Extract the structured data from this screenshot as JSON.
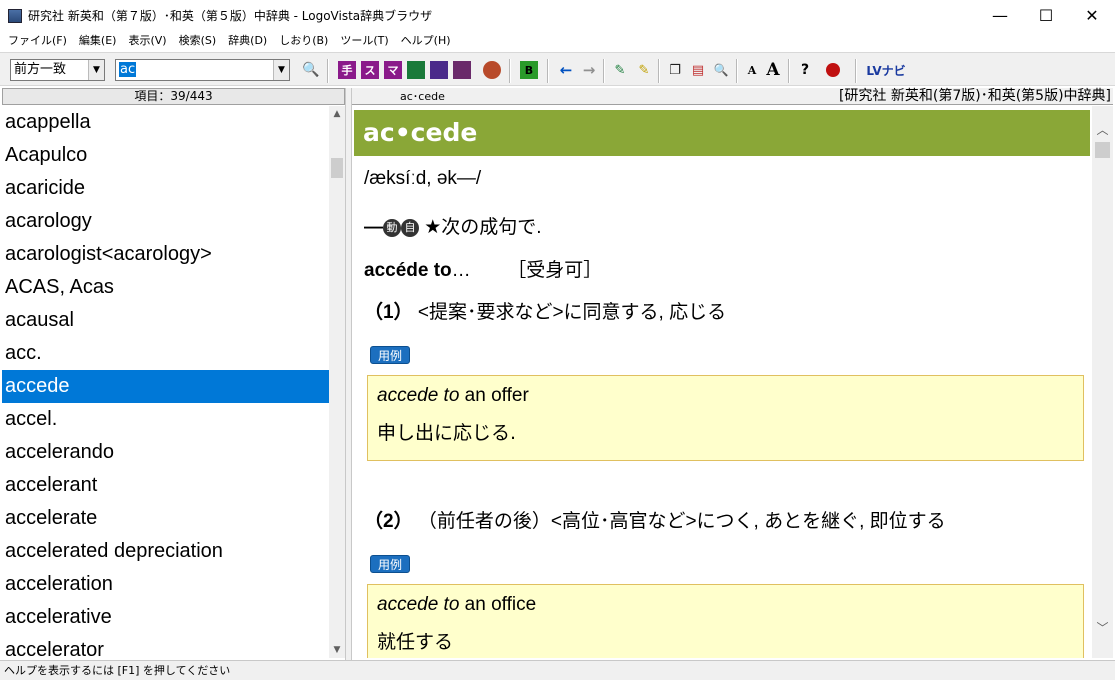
{
  "window": {
    "title": "研究社 新英和（第７版）･和英（第５版）中辞典 - LogoVista辞典ブラウザ",
    "minimize": "—",
    "maximize": "☐",
    "close": "✕"
  },
  "menu": [
    "ファイル(F)",
    "編集(E)",
    "表示(V)",
    "検索(S)",
    "辞典(D)",
    "しおり(B)",
    "ツール(T)",
    "ヘルプ(H)"
  ],
  "toolbar": {
    "search_mode": "前方一致",
    "search_query": "ac",
    "buttons": {
      "find": "🔍",
      "te": "手",
      "su": "ス",
      "ma": "マ",
      "b": "B",
      "back": "←",
      "forward": "→",
      "zoom": "🔍",
      "font_small": "A",
      "font_large": "A",
      "help": "?",
      "lv": "LVナビ"
    }
  },
  "left_pane": {
    "header": "項目：39/443",
    "items": [
      "acappella",
      "Acapulco",
      "acaricide",
      "acarology",
      "acarologist<acarology>",
      "ACAS, Acas",
      "acausal",
      "acc.",
      "accede",
      "accel.",
      "accelerando",
      "accelerant",
      "accelerate",
      "accelerated depreciation",
      "acceleration",
      "accelerative",
      "accelerator"
    ],
    "selected_index": 8
  },
  "right_pane": {
    "tab_label": "ac･cede",
    "dictionary_name": "[研究社 新英和(第7版)･和英(第5版)中辞典]",
    "headword": "ac•cede",
    "pronunciation": "/æksíːd, ək—/",
    "pos_dash": "—",
    "pos_verb": "動",
    "pos_intr": "自",
    "pos_note": " ★次の成句で.",
    "phrase": "accéde to",
    "phrase_dots": "…",
    "phrase_note": "［受身可］",
    "sense1_num": "（1）",
    "sense1_text": " <提案･要求など>に同意する, 応じる",
    "example_label": "用例",
    "example1_en_italic": "accede to",
    "example1_en_rest": " an offer",
    "example1_ja": "申し出に応じる.",
    "sense2_num": "（2）",
    "sense2_text": " （前任者の後）<高位･高官など>につく, あとを継ぐ, 即位する",
    "example2_en_italic": "accede to",
    "example2_en_rest": " an office",
    "example2_ja": "就任する"
  },
  "statusbar": {
    "text": "ヘルプを表示するには [F1] を押してください"
  }
}
